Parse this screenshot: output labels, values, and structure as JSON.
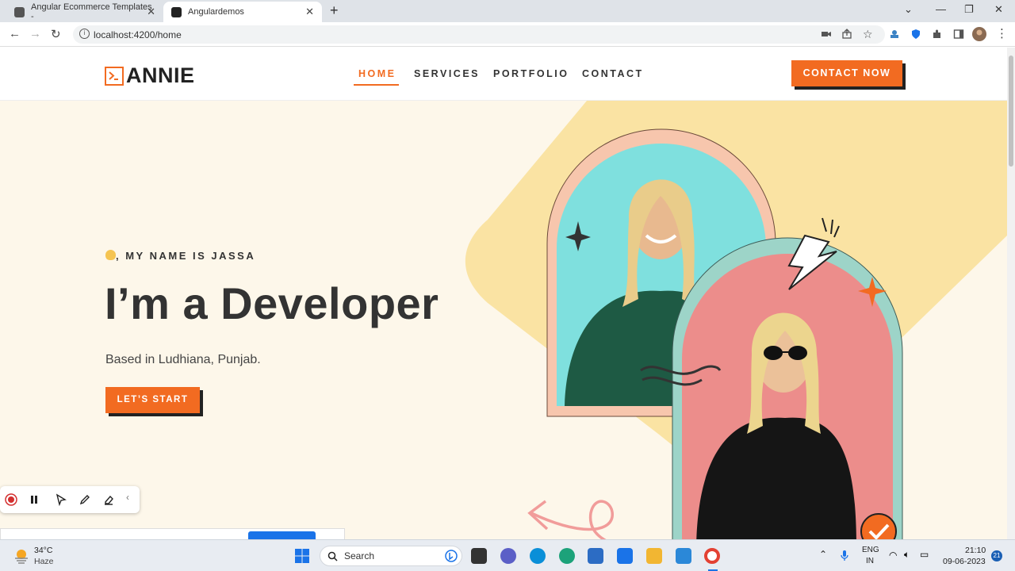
{
  "browser": {
    "tabs": [
      {
        "title": "Angular Ecommerce Templates -"
      },
      {
        "title": "Angulardemos"
      }
    ],
    "url": "localhost:4200/home"
  },
  "site": {
    "logo_text": "ANNIE",
    "nav": {
      "home": "HOME",
      "services": "SERVICES",
      "portfolio": "PORTFOLIO",
      "contact": "CONTACT"
    },
    "contact_button": "CONTACT NOW",
    "hero": {
      "greeting": ", MY NAME IS JASSA",
      "headline": "I’m a Developer",
      "location": "Based in Ludhiana, Punjab.",
      "cta": "LET’S START"
    },
    "colors": {
      "accent": "#f26b21",
      "background": "#fdf7ea",
      "shape": "#fae3a3",
      "arch_back": "#f7c6ad",
      "arch_front": "#9dd4c8"
    }
  },
  "taskbar": {
    "weather_temp": "34°C",
    "weather_desc": "Haze",
    "search_label": "Search",
    "lang_line1": "ENG",
    "lang_line2": "IN",
    "time": "21:10",
    "date": "09-06-2023",
    "notification_count": "21"
  }
}
